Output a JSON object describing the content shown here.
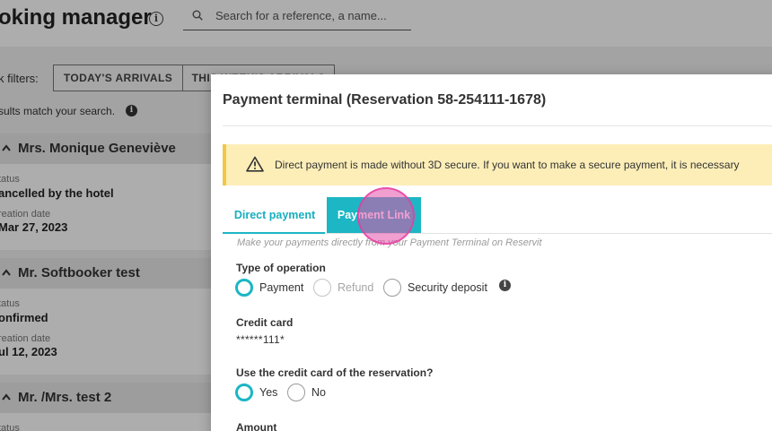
{
  "app": {
    "title": "oking manager",
    "search_placeholder": "Search for a reference, a name..."
  },
  "filters": {
    "label": "k filters:",
    "buttons": [
      "TODAY'S ARRIVALS",
      "THIS WEEK'S ARRIVALS"
    ]
  },
  "results": {
    "text": "sults match your search."
  },
  "reservations": [
    {
      "name": "Mrs. Monique Geneviève",
      "status_label": "tatus",
      "status": "ancelled by the hotel",
      "created_label": "reation date",
      "created": "Mar 27, 2023"
    },
    {
      "name": "Mr. Softbooker test",
      "status_label": "tatus",
      "status": "onfirmed",
      "created_label": "reation date",
      "created": "ul 12, 2023"
    },
    {
      "name": "Mr. /Mrs. test 2",
      "status_label": "tatus"
    }
  ],
  "modal": {
    "title": "Payment terminal (Reservation 58-254111-1678)",
    "alert": "Direct payment is made without 3D secure. If you want to make a secure payment, it is necessary",
    "tabs": {
      "direct": "Direct payment",
      "link": "Payment Link"
    },
    "hint": "Make your payments directly from your Payment Terminal on Reservit",
    "operation": {
      "label": "Type of operation",
      "options": [
        "Payment",
        "Refund",
        "Security deposit"
      ],
      "selected": "Payment"
    },
    "credit_card": {
      "label": "Credit card",
      "value": "******111*"
    },
    "use_card": {
      "label": "Use the credit card of the reservation?",
      "options": [
        "Yes",
        "No"
      ],
      "selected": "Yes"
    },
    "amount": {
      "label": "Amount"
    }
  },
  "colors": {
    "accent": "#1cb6c4",
    "alert_bg": "#fdeeb8",
    "click_indicator": "#e650aa"
  }
}
